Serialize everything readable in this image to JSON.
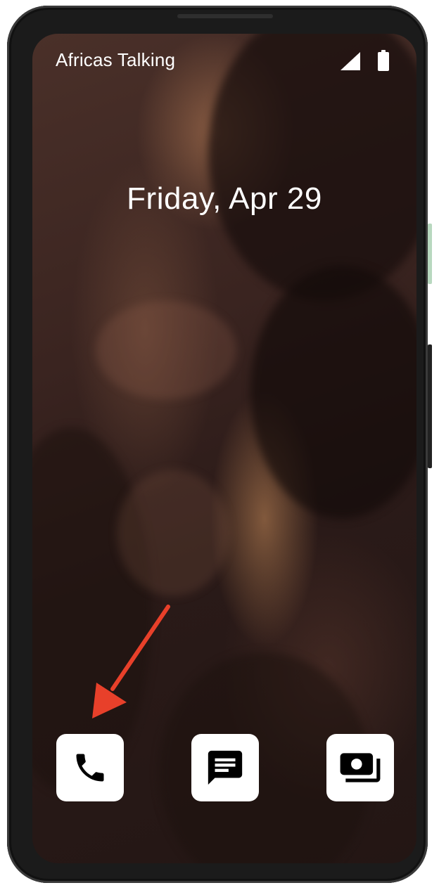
{
  "status_bar": {
    "carrier": "Africas Talking",
    "signal_icon": "cellular-signal-icon",
    "battery_icon": "battery-full-icon"
  },
  "lock_screen": {
    "date": "Friday, Apr 29"
  },
  "dock": {
    "items": [
      {
        "name": "phone",
        "icon": "phone-icon"
      },
      {
        "name": "messages",
        "icon": "message-icon"
      },
      {
        "name": "payments",
        "icon": "money-icon"
      }
    ]
  },
  "annotation": {
    "arrow_color": "#e8402a",
    "points_to": "phone"
  }
}
